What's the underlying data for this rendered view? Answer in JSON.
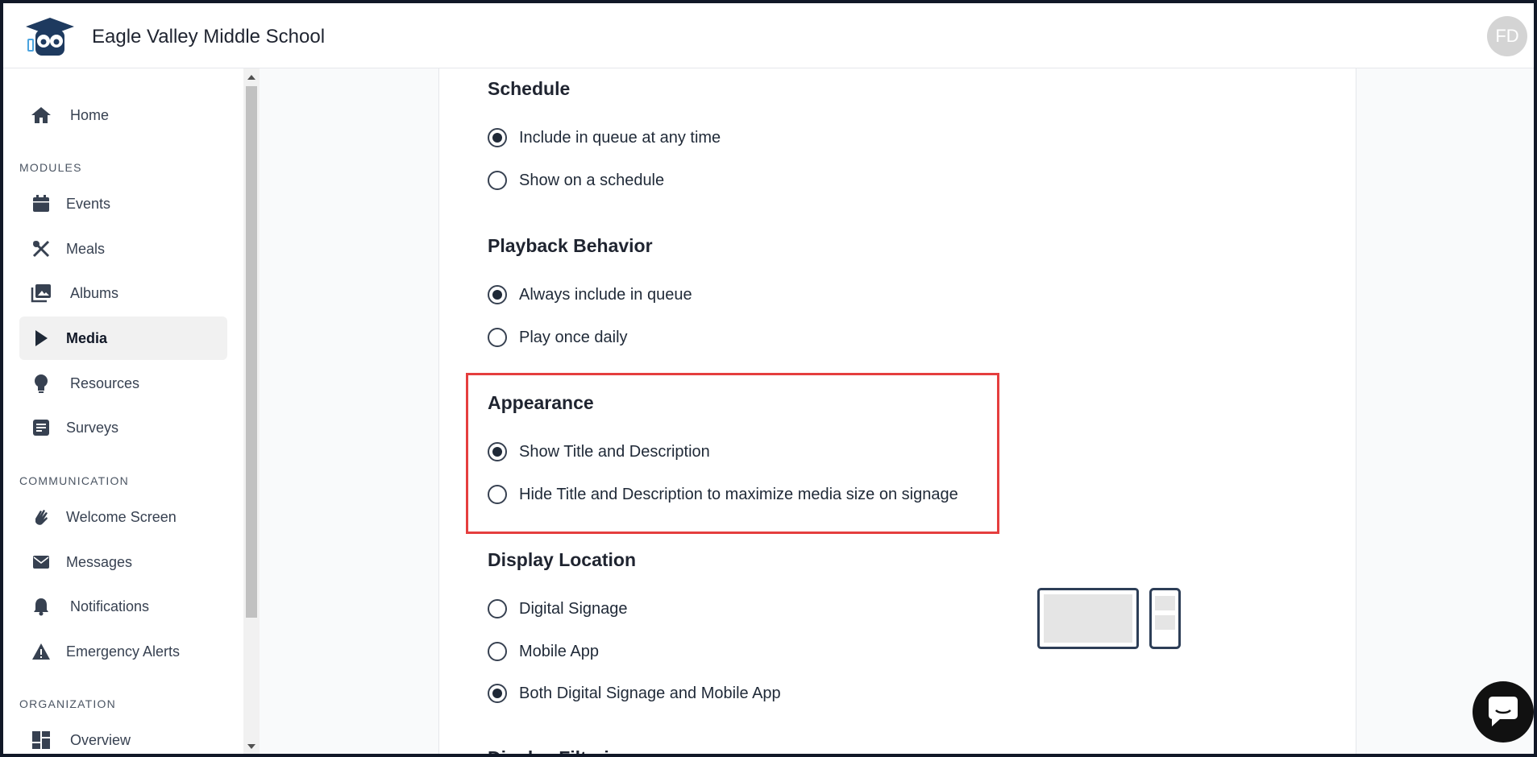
{
  "header": {
    "school_name": "Eagle Valley Middle School",
    "avatar_initials": "FD"
  },
  "sidebar": {
    "home": {
      "label": "Home",
      "icon": "home-icon"
    },
    "sections": {
      "modules": "MODULES",
      "communication": "COMMUNICATION",
      "organization": "ORGANIZATION"
    },
    "modules": [
      {
        "label": "Events",
        "icon": "calendar-icon"
      },
      {
        "label": "Meals",
        "icon": "utensils-icon"
      },
      {
        "label": "Albums",
        "icon": "photo-album-icon"
      },
      {
        "label": "Media",
        "icon": "play-icon",
        "active": true
      },
      {
        "label": "Resources",
        "icon": "lightbulb-icon"
      },
      {
        "label": "Surveys",
        "icon": "survey-form-icon"
      }
    ],
    "communication": [
      {
        "label": "Welcome Screen",
        "icon": "waving-hand-icon"
      },
      {
        "label": "Messages",
        "icon": "envelope-icon"
      },
      {
        "label": "Notifications",
        "icon": "bell-icon"
      },
      {
        "label": "Emergency Alerts",
        "icon": "warning-icon"
      }
    ],
    "organization": [
      {
        "label": "Overview",
        "icon": "dashboard-icon"
      }
    ]
  },
  "form": {
    "schedule": {
      "title": "Schedule",
      "options": [
        {
          "label": "Include in queue at any time",
          "checked": true
        },
        {
          "label": "Show on a schedule",
          "checked": false
        }
      ]
    },
    "playback": {
      "title": "Playback Behavior",
      "options": [
        {
          "label": "Always include in queue",
          "checked": true
        },
        {
          "label": "Play once daily",
          "checked": false
        }
      ]
    },
    "appearance": {
      "title": "Appearance",
      "options": [
        {
          "label": "Show Title and Description",
          "checked": true
        },
        {
          "label": "Hide Title and Description to maximize media size on signage",
          "checked": false
        }
      ]
    },
    "display_location": {
      "title": "Display Location",
      "options": [
        {
          "label": "Digital Signage",
          "checked": false
        },
        {
          "label": "Mobile App",
          "checked": false
        },
        {
          "label": "Both Digital Signage and Mobile App",
          "checked": true
        }
      ]
    },
    "next_section_title": "Display Filtering"
  },
  "colors": {
    "highlight": "#e53e3e",
    "device_stroke": "#2d3e57"
  }
}
